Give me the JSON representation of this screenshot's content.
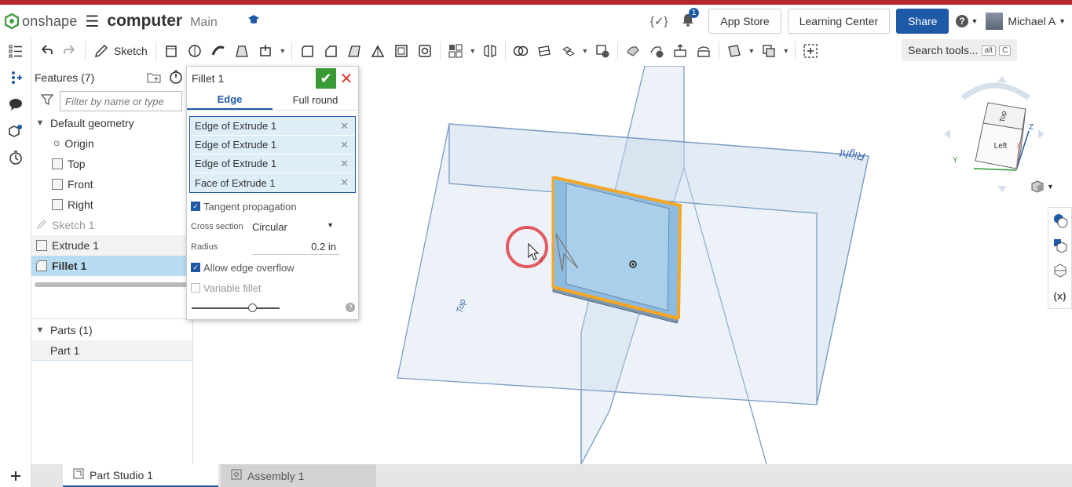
{
  "header": {
    "brand": "onshape",
    "doc_title": "computer",
    "workspace": "Main",
    "notification_count": "1",
    "app_store": "App Store",
    "learning_center": "Learning Center",
    "share": "Share",
    "user_name": "Michael A"
  },
  "toolbar": {
    "sketch_label": "Sketch",
    "search_label": "Search tools...",
    "kbd1": "alt",
    "kbd2": "C"
  },
  "features": {
    "title": "Features (7)",
    "filter_placeholder": "Filter by name or type",
    "default_geometry": "Default geometry",
    "items": [
      "Origin",
      "Top",
      "Front",
      "Right",
      "Sketch 1",
      "Extrude 1",
      "Fillet 1"
    ],
    "parts_title": "Parts (1)",
    "part_1": "Part 1"
  },
  "dialog": {
    "title": "Fillet 1",
    "tab_edge": "Edge",
    "tab_full_round": "Full round",
    "selections": [
      "Edge of Extrude 1",
      "Edge of Extrude 1",
      "Edge of Extrude 1",
      "Face of Extrude 1"
    ],
    "tangent_propagation": "Tangent propagation",
    "cross_section_label": "Cross section",
    "cross_section_value": "Circular",
    "radius_label": "Radius",
    "radius_value": "0.2 in",
    "allow_edge_overflow": "Allow edge overflow",
    "variable_fillet": "Variable fillet"
  },
  "viewport": {
    "plane_top": "Top",
    "plane_right": "Right",
    "cube_top": "Top",
    "cube_left": "Left",
    "axis_y": "Y",
    "axis_z": "Z",
    "axis_x": "X",
    "edge_count": "4"
  },
  "bottom_tabs": {
    "part_studio": "Part Studio 1",
    "assembly": "Assembly 1"
  },
  "colors": {
    "accent": "#1f5aa6",
    "selection": "#f5a623",
    "ok": "#3a9a36",
    "cancel": "#d9392b",
    "brand_red": "#b5272d"
  }
}
